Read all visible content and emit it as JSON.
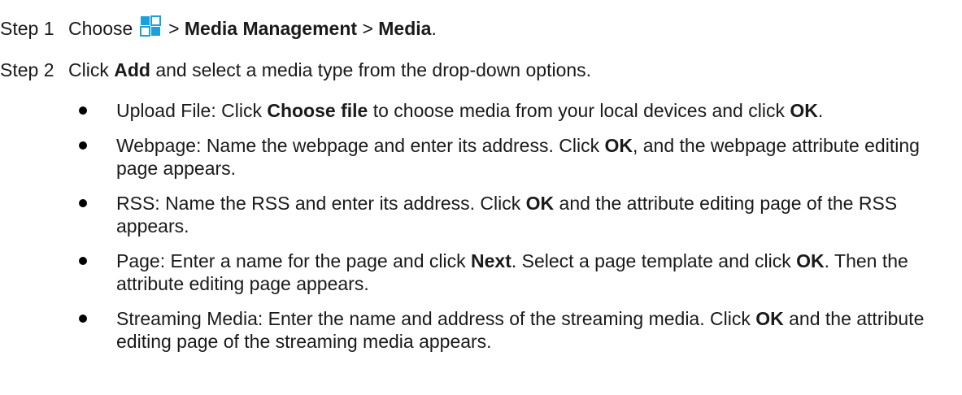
{
  "step1": {
    "label": "Step 1",
    "prefix": "Choose",
    "icon": "grid-menu-icon",
    "icon_color": "#1aa1d9",
    "sep1": ">",
    "menu": "Media Management",
    "sep2": ">",
    "item": "Media",
    "end": "."
  },
  "step2": {
    "label": "Step 2",
    "pre": "Click",
    "add": "Add",
    "post": "and select a media type from the drop-down options."
  },
  "bullets": [
    {
      "t1": "Upload File: Click",
      "b1": "Choose file",
      "t2": "to choose media from your local devices and click",
      "b2": "OK",
      "t3": "."
    },
    {
      "t1": "Webpage: Name the webpage and enter its address. Click",
      "b1": "OK",
      "t2": ", and the webpage attribute editing page appears."
    },
    {
      "t1": "RSS: Name the RSS and enter its address. Click",
      "b1": "OK",
      "t2": "and the attribute editing page of the RSS appears."
    },
    {
      "t1": "Page: Enter a name for the page and click",
      "b1": "Next",
      "t2": ". Select a page template and click",
      "b2": "OK",
      "t3": ". Then the attribute editing page appears."
    },
    {
      "t1": "Streaming Media: Enter the name and address of the streaming media. Click",
      "b1": "OK",
      "t2": "and the attribute editing page of the streaming media appears."
    }
  ]
}
